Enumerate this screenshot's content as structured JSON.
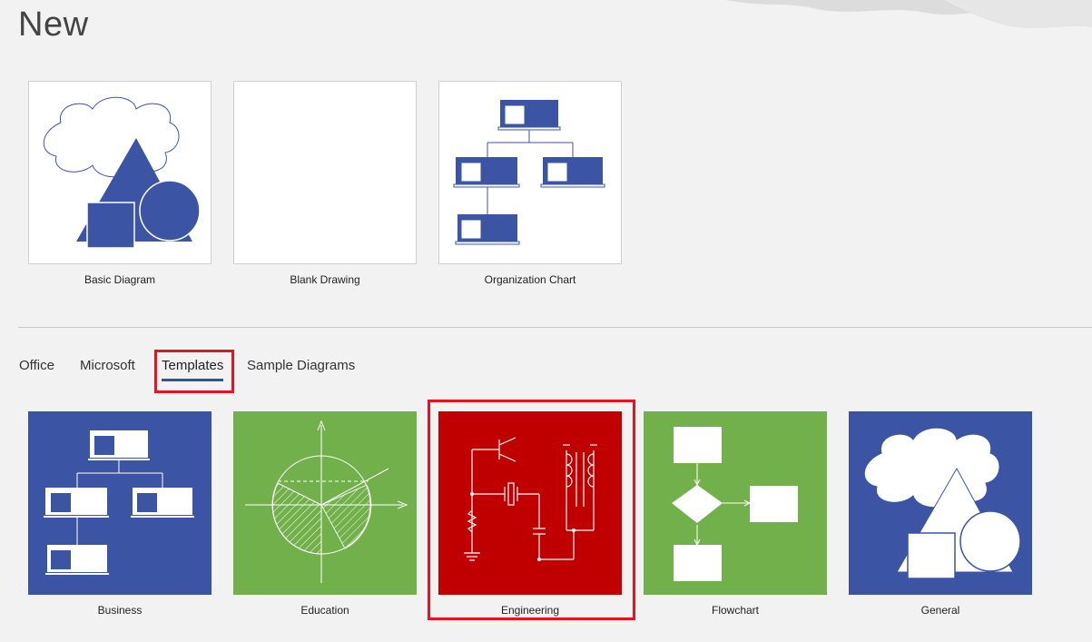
{
  "header": {
    "title": "New"
  },
  "featured": [
    {
      "label": "Basic Diagram"
    },
    {
      "label": "Blank Drawing"
    },
    {
      "label": "Organization Chart"
    }
  ],
  "tabs": [
    {
      "label": "Office"
    },
    {
      "label": "Microsoft"
    },
    {
      "label": "Templates",
      "active": true
    },
    {
      "label": "Sample Diagrams"
    }
  ],
  "categories": [
    {
      "label": "Business",
      "color": "#3b55a4"
    },
    {
      "label": "Education",
      "color": "#71b04a"
    },
    {
      "label": "Engineering",
      "color": "#c00000",
      "highlighted": true
    },
    {
      "label": "Flowchart",
      "color": "#71b04a"
    },
    {
      "label": "General",
      "color": "#3b55a4"
    }
  ],
  "colors": {
    "accent": "#2b579a",
    "highlight": "#e0151f",
    "visio_blue": "#3b55a4"
  }
}
